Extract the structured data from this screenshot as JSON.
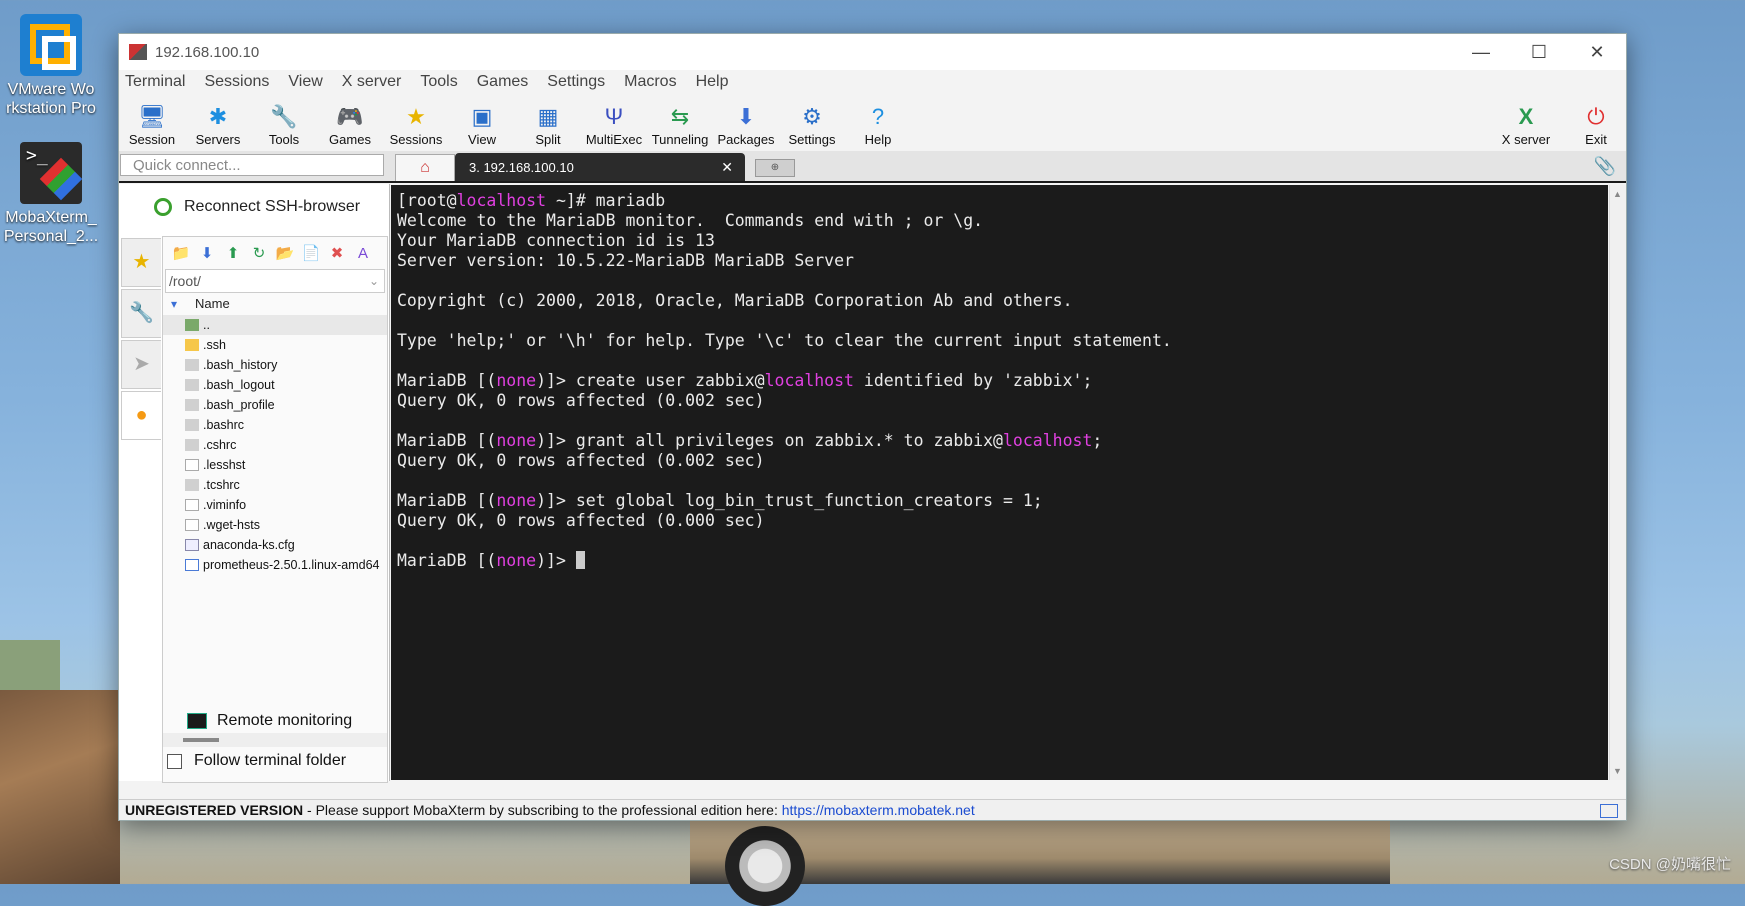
{
  "desktop": {
    "icons": [
      {
        "label": "VMware Workstation Pro",
        "line1": "VMware Wo",
        "line2": "rkstation Pro"
      },
      {
        "label": "MobaXterm_Personal_2...",
        "line1": "MobaXterm_",
        "line2": "Personal_2..."
      }
    ],
    "watermark": "CSDN @奶嘴很忙"
  },
  "window": {
    "title": "192.168.100.10",
    "controls": {
      "minimize": "—",
      "maximize": "☐",
      "close": "✕"
    }
  },
  "menubar": [
    "Terminal",
    "Sessions",
    "View",
    "X server",
    "Tools",
    "Games",
    "Settings",
    "Macros",
    "Help"
  ],
  "toolbar": {
    "left": [
      {
        "label": "Session",
        "icon": "session-icon",
        "glyph": "🖥",
        "color": "#2a6fc9"
      },
      {
        "label": "Servers",
        "icon": "servers-icon",
        "glyph": "✱",
        "color": "#1d8fe0"
      },
      {
        "label": "Tools",
        "icon": "tools-icon",
        "glyph": "🔧",
        "color": "#d33"
      },
      {
        "label": "Games",
        "icon": "games-icon",
        "glyph": "🎮",
        "color": "#666"
      },
      {
        "label": "Sessions",
        "icon": "star-icon",
        "glyph": "★",
        "color": "#e8b400"
      },
      {
        "label": "View",
        "icon": "view-icon",
        "glyph": "▣",
        "color": "#2a6fc9"
      },
      {
        "label": "Split",
        "icon": "split-icon",
        "glyph": "▦",
        "color": "#2a6fc9"
      },
      {
        "label": "MultiExec",
        "icon": "multiexec-icon",
        "glyph": "Ψ",
        "color": "#3b4fc0"
      },
      {
        "label": "Tunneling",
        "icon": "tunneling-icon",
        "glyph": "⇆",
        "color": "#2a9a50"
      },
      {
        "label": "Packages",
        "icon": "packages-icon",
        "glyph": "⬇",
        "color": "#3b6fd6"
      },
      {
        "label": "Settings",
        "icon": "settings-icon",
        "glyph": "⚙",
        "color": "#2a6fc9"
      },
      {
        "label": "Help",
        "icon": "help-icon",
        "glyph": "?",
        "color": "#1d8fe0"
      }
    ],
    "xserver": {
      "label": "X server",
      "glyph": "X",
      "color": "#2a9a50"
    },
    "exit": {
      "label": "Exit",
      "glyph": "⏻",
      "color": "#e03030"
    }
  },
  "tabs": {
    "quick_connect_placeholder": "Quick connect...",
    "home_glyph": "⌂",
    "active": {
      "label": "3. 192.168.100.10",
      "close": "✕"
    },
    "new_tab_glyph": "⊕",
    "attach_glyph": "📎"
  },
  "sidebar": {
    "reconnect_label": "Reconnect SSH-browser",
    "vtabs": [
      {
        "name": "sessions",
        "glyph": "★"
      },
      {
        "name": "tools",
        "glyph": "🔧"
      },
      {
        "name": "macros",
        "glyph": "➤"
      },
      {
        "name": "sftp",
        "glyph": "●"
      }
    ],
    "file_toolbar": [
      "📁",
      "⬇",
      "⬆",
      "↻",
      "📂",
      "📄",
      "✖",
      "A"
    ],
    "path": "/root/",
    "column_name": "Name",
    "files": [
      {
        "name": "..",
        "type": "up"
      },
      {
        "name": ".ssh",
        "type": "folder"
      },
      {
        "name": ".bash_history",
        "type": "file"
      },
      {
        "name": ".bash_logout",
        "type": "file"
      },
      {
        "name": ".bash_profile",
        "type": "file"
      },
      {
        "name": ".bashrc",
        "type": "file"
      },
      {
        "name": ".cshrc",
        "type": "file"
      },
      {
        "name": ".lesshst",
        "type": "doc"
      },
      {
        "name": ".tcshrc",
        "type": "file"
      },
      {
        "name": ".viminfo",
        "type": "doc"
      },
      {
        "name": ".wget-hsts",
        "type": "doc"
      },
      {
        "name": "anaconda-ks.cfg",
        "type": "cfg"
      },
      {
        "name": "prometheus-2.50.1.linux-amd64",
        "type": "info"
      }
    ],
    "remote_monitoring": "Remote monitoring",
    "follow_terminal_folder": "Follow terminal folder"
  },
  "terminal": {
    "lines": [
      [
        [
          "[root@",
          ""
        ],
        [
          "localhost",
          "m"
        ],
        [
          " ~]# mariadb",
          ""
        ]
      ],
      [
        [
          "Welcome to the MariaDB monitor.  Commands end with ; or \\g.",
          ""
        ]
      ],
      [
        [
          "Your MariaDB connection id is 13",
          ""
        ]
      ],
      [
        [
          "Server version: 10.5.22-MariaDB MariaDB Server",
          ""
        ]
      ],
      [],
      [
        [
          "Copyright (c) 2000, 2018, Oracle, MariaDB Corporation Ab and others.",
          ""
        ]
      ],
      [],
      [
        [
          "Type 'help;' or '\\h' for help. Type '\\c' to clear the current input statement.",
          ""
        ]
      ],
      [],
      [
        [
          "MariaDB [(",
          ""
        ],
        [
          "none",
          "m"
        ],
        [
          ")]> create user zabbix@",
          ""
        ],
        [
          "localhost",
          "m"
        ],
        [
          " identified by 'zabbix';",
          ""
        ]
      ],
      [
        [
          "Query OK, 0 rows affected (0.002 sec)",
          ""
        ]
      ],
      [],
      [
        [
          "MariaDB [(",
          ""
        ],
        [
          "none",
          "m"
        ],
        [
          ")]> grant all privileges on zabbix.* to zabbix@",
          ""
        ],
        [
          "localhost",
          "m"
        ],
        [
          ";",
          ""
        ]
      ],
      [
        [
          "Query OK, 0 rows affected (0.002 sec)",
          ""
        ]
      ],
      [],
      [
        [
          "MariaDB [(",
          ""
        ],
        [
          "none",
          "m"
        ],
        [
          ")]> set global log_bin_trust_function_creators = 1;",
          ""
        ]
      ],
      [
        [
          "Query OK, 0 rows affected (0.000 sec)",
          ""
        ]
      ],
      [],
      [
        [
          "MariaDB [(",
          ""
        ],
        [
          "none",
          "m"
        ],
        [
          ")]> ",
          ""
        ]
      ]
    ],
    "colors": {
      "background": "#1b1b1b",
      "text": "#eaeaea",
      "highlight": "#e040e0"
    }
  },
  "statusbar": {
    "unregistered": "UNREGISTERED VERSION",
    "separator": " -  ",
    "message": "Please support MobaXterm by subscribing to the professional edition here:  ",
    "link": "https://mobaxterm.mobatek.net"
  }
}
